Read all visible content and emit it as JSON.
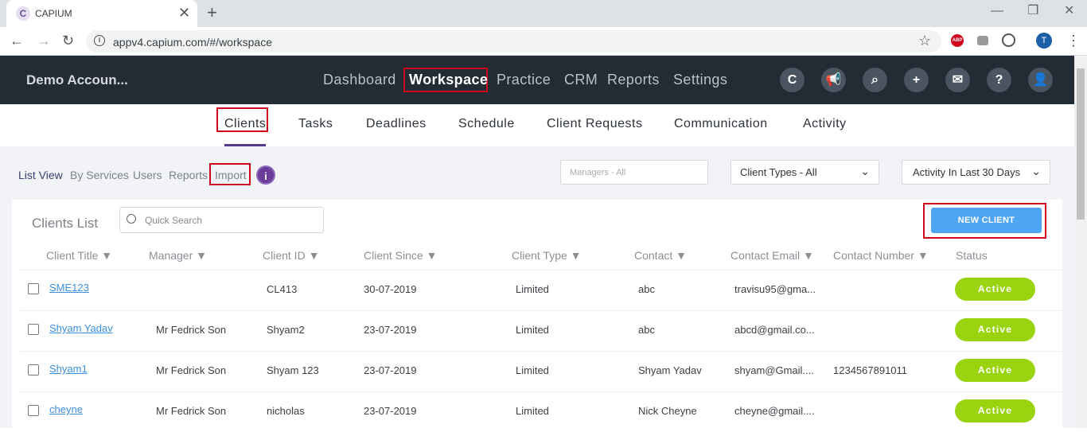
{
  "browser": {
    "tab_title": "CAPIUM",
    "favicon_letter": "C",
    "url": "appv4.capium.com/#/workspace",
    "profile_initial": "T",
    "adblock_label": "ABP"
  },
  "header": {
    "account": "Demo Accoun...",
    "nav": [
      "Dashboard",
      "Workspace",
      "Practice",
      "CRM",
      "Reports",
      "Settings"
    ],
    "active_nav": "Workspace",
    "icons": [
      "capium-logo-icon",
      "megaphone-icon",
      "search-icon",
      "plus-icon",
      "mail-icon",
      "help-icon",
      "user-icon"
    ]
  },
  "subnav": {
    "items": [
      "Clients",
      "Tasks",
      "Deadlines",
      "Schedule",
      "Client Requests",
      "Communication",
      "Activity"
    ],
    "active": "Clients"
  },
  "views": {
    "items": [
      "List View",
      "By Services",
      "Users",
      "Reports",
      "Import"
    ],
    "active": "List View"
  },
  "filters": {
    "managers_placeholder": "Managers - All",
    "client_types": "Client Types - All",
    "activity": "Activity In Last 30 Days"
  },
  "list": {
    "title": "Clients List",
    "search_placeholder": "Quick Search",
    "new_client_label": "NEW CLIENT",
    "columns": [
      "Client Title ▼",
      "Manager ▼",
      "Client ID ▼",
      "Client Since ▼",
      "Client Type ▼",
      "Contact ▼",
      "Contact Email ▼",
      "Contact Number ▼",
      "Status"
    ],
    "rows": [
      {
        "title": "SME123",
        "manager": "",
        "client_id": "CL413",
        "since": "30-07-2019",
        "type": "Limited",
        "contact": "abc",
        "email": "travisu95@gma...",
        "number": "",
        "status": "Active"
      },
      {
        "title": "Shyam Yadav",
        "manager": "Mr Fedrick Son",
        "client_id": "Shyam2",
        "since": "23-07-2019",
        "type": "Limited",
        "contact": "abc",
        "email": "abcd@gmail.co...",
        "number": "",
        "status": "Active"
      },
      {
        "title": "Shyam1",
        "manager": "Mr Fedrick Son",
        "client_id": "Shyam 123",
        "since": "23-07-2019",
        "type": "Limited",
        "contact": "Shyam Yadav",
        "email": "shyam@Gmail....",
        "number": "1234567891011",
        "status": "Active"
      },
      {
        "title": "cheyne",
        "manager": "Mr Fedrick Son",
        "client_id": "nicholas",
        "since": "23-07-2019",
        "type": "Limited",
        "contact": "Nick Cheyne",
        "email": "cheyne@gmail....",
        "number": "",
        "status": "Active"
      }
    ]
  },
  "colors": {
    "header_bg": "#232b35",
    "accent_purple": "#5c3a8e",
    "new_client_blue": "#4ea5f2",
    "status_green": "#9ad310",
    "highlight_red": "#d0021b"
  }
}
